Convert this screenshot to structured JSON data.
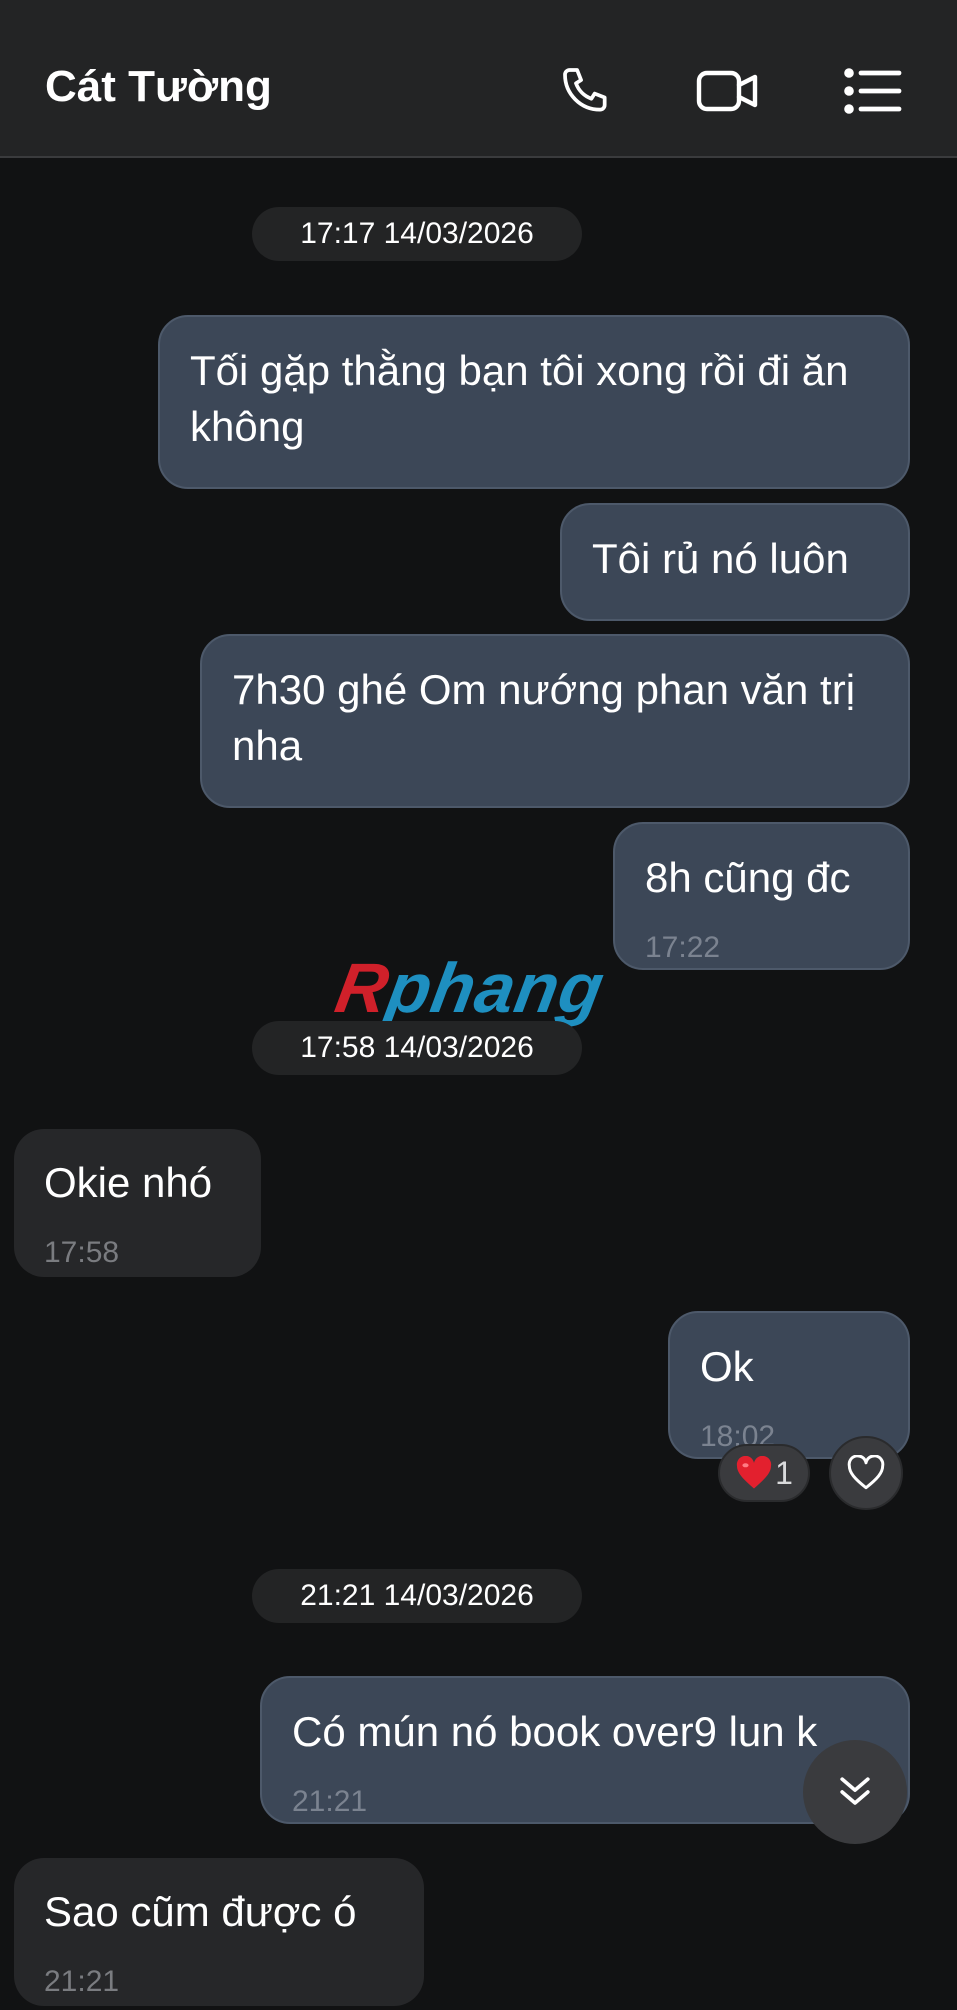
{
  "header": {
    "title": "Cát Tường",
    "icons": [
      "phone-icon",
      "video-call-icon",
      "menu-list-icon"
    ]
  },
  "timestamps": [
    "17:17 14/03/2026",
    "17:58 14/03/2026",
    "21:21 14/03/2026"
  ],
  "messages": [
    {
      "dir": "out",
      "text": "Tối gặp thằng bạn tôi xong rồi đi ăn không"
    },
    {
      "dir": "out",
      "text": "Tôi rủ nó luôn"
    },
    {
      "dir": "out",
      "text": "7h30 ghé Om nướng phan văn trị nha"
    },
    {
      "dir": "out",
      "text": "8h cũng đc",
      "time": "17:22"
    },
    {
      "dir": "in",
      "text": "Okie nhó",
      "time": "17:58"
    },
    {
      "dir": "out",
      "text": "Ok",
      "time": "18:02"
    },
    {
      "dir": "out",
      "text": "Có mún nó book over9 lun k",
      "time": "21:21"
    },
    {
      "dir": "in",
      "text": "Sao cũm được ó",
      "time": "21:21"
    }
  ],
  "reaction": {
    "emoji": "heart",
    "count": "1"
  },
  "watermark": {
    "first": "R",
    "rest": "phang"
  },
  "colors": {
    "outgoing_bubble": "#3c4757",
    "incoming_bubble": "#262729",
    "background": "#111213"
  }
}
